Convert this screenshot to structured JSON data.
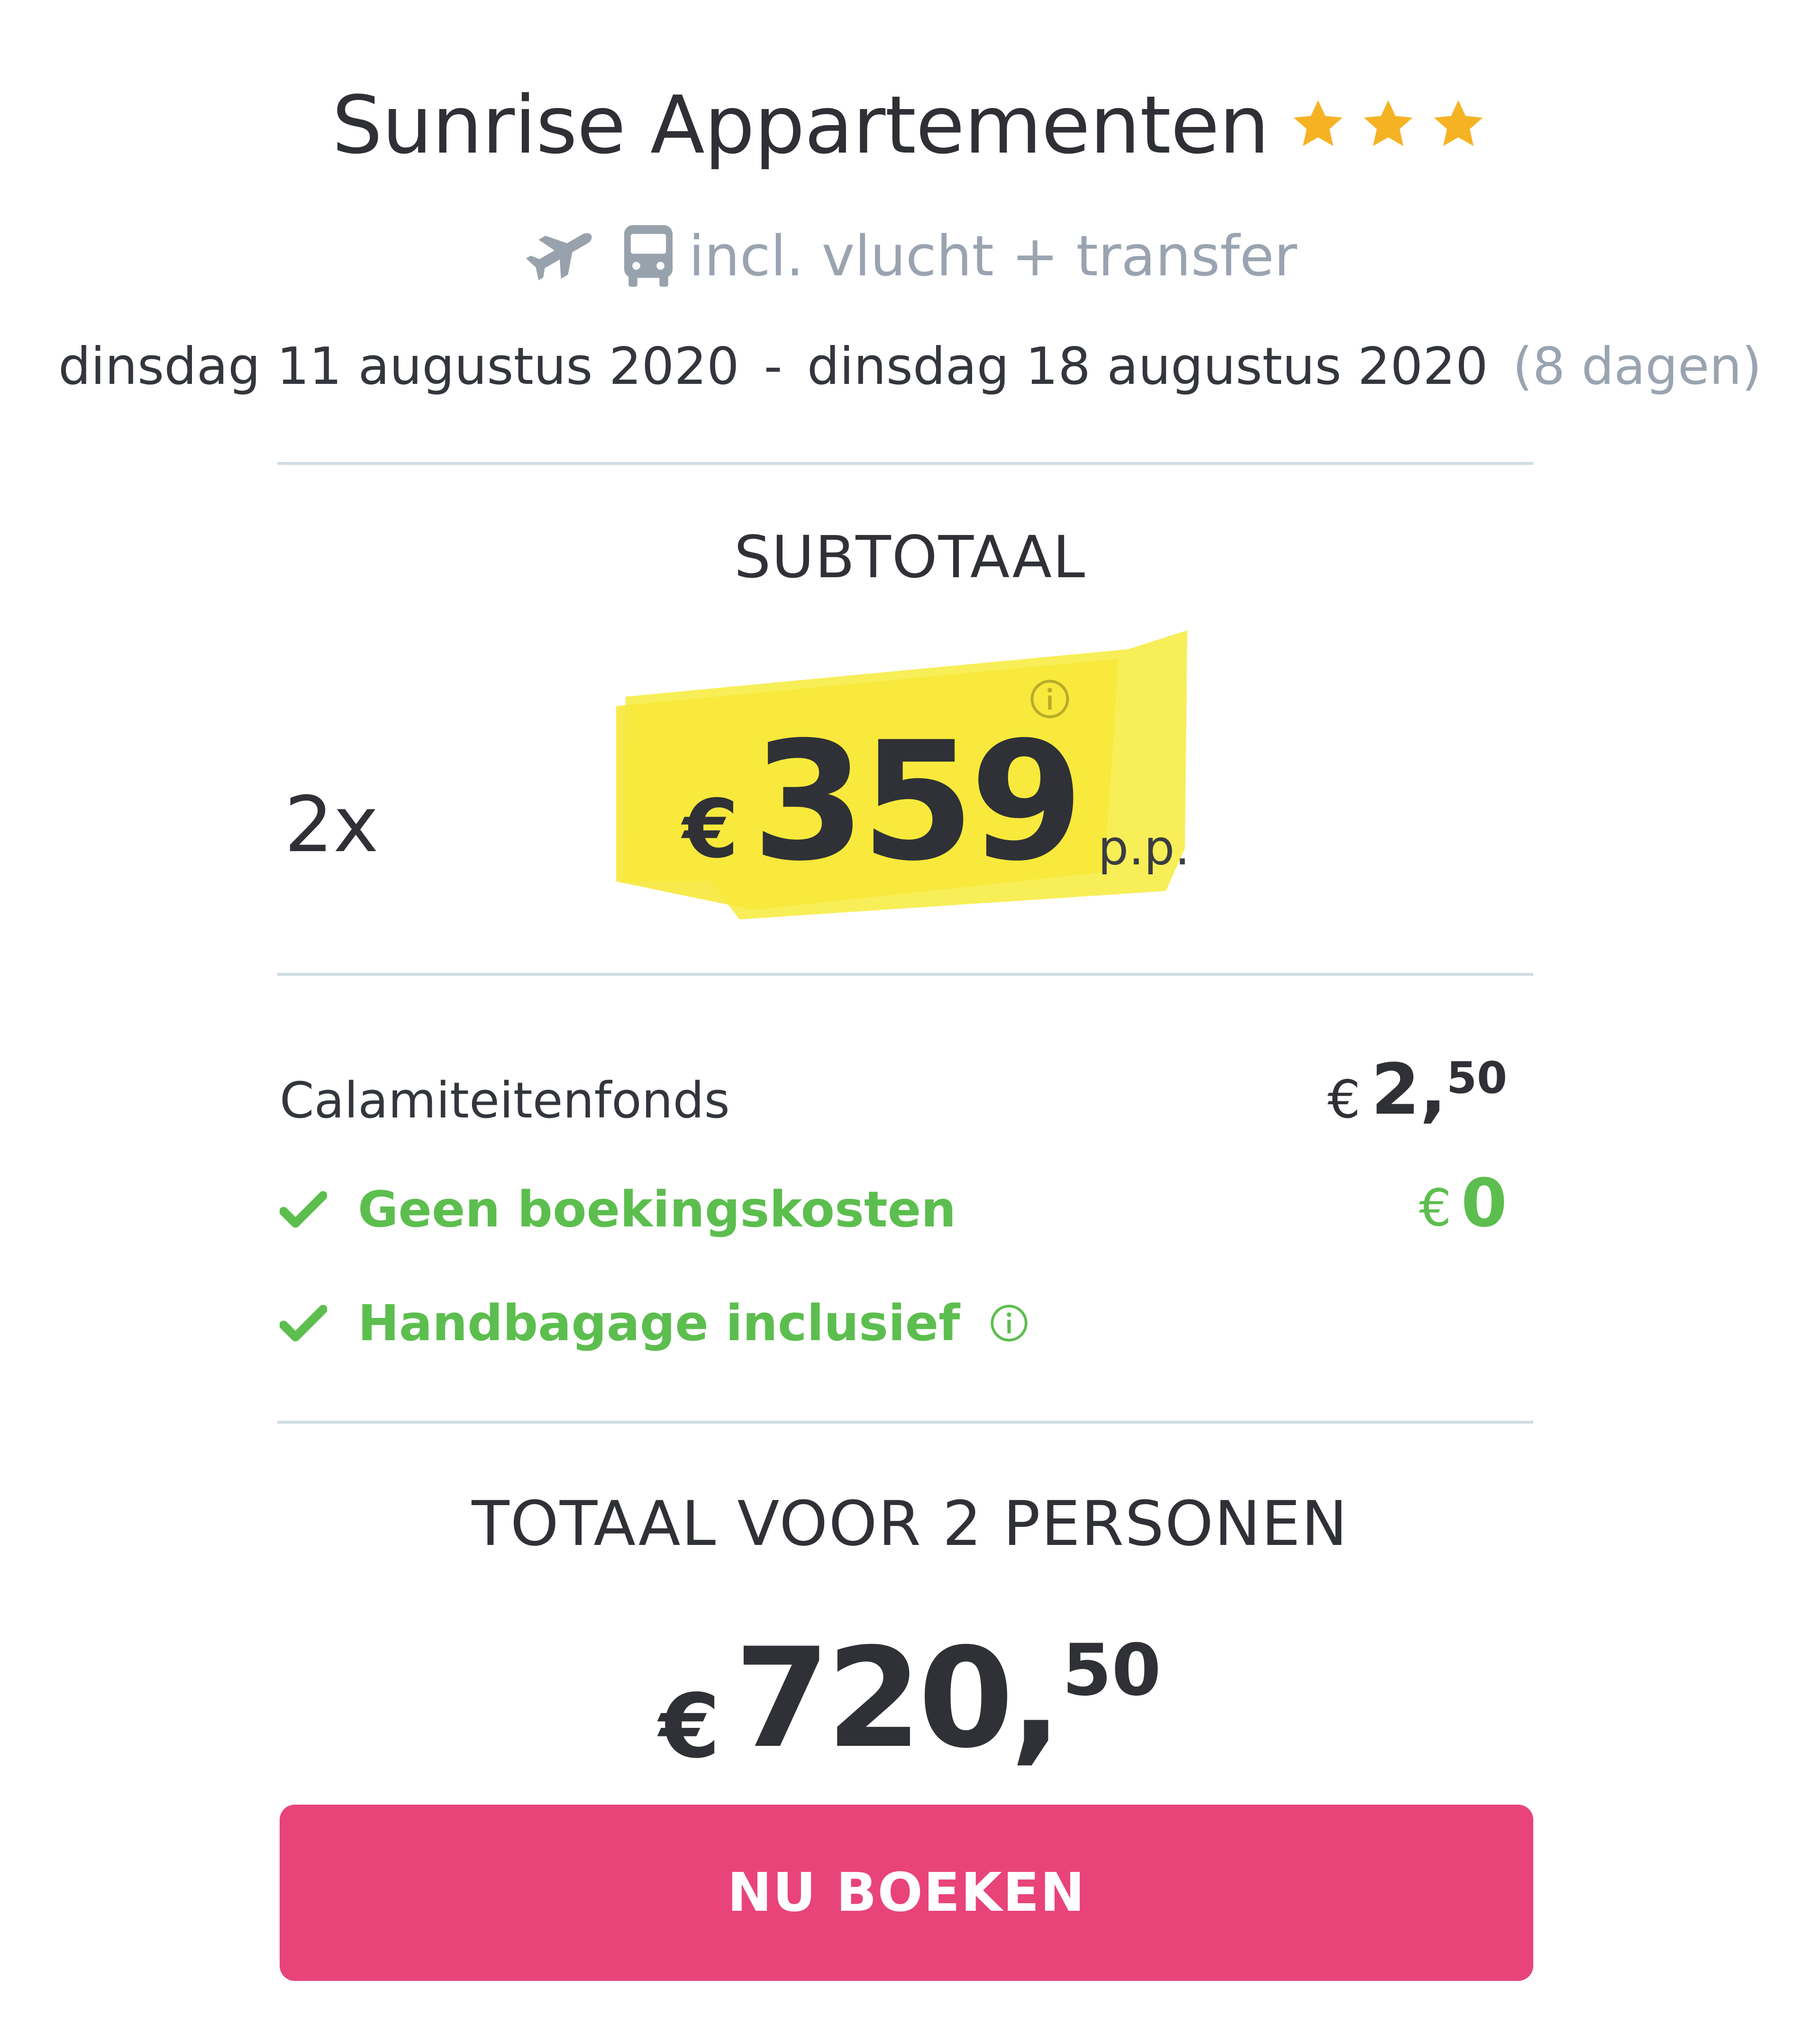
{
  "header": {
    "hotel_name": "Sunrise Appartementen",
    "stars": 3,
    "star_color": "#f5b324",
    "includes_icons": [
      "airplane-icon",
      "bus-icon"
    ],
    "includes_text": "incl. vlucht + transfer",
    "date_from": "dinsdag 11 augustus 2020",
    "date_separator": "-",
    "date_to": "dinsdag 18 augustus 2020",
    "duration": "(8 dagen)"
  },
  "subtotal": {
    "label": "SUBTOTAAL",
    "quantity": "2x",
    "currency": "€",
    "price": "359",
    "per_person": "p.p.",
    "highlight_color": "#f7eb3a"
  },
  "fees": {
    "calamity_label": "Calamiteitenfonds",
    "calamity_currency": "€",
    "calamity_whole": "2,",
    "calamity_cents": "50",
    "booking_label": "Geen boekingskosten",
    "booking_currency": "€",
    "booking_value": "0",
    "baggage_label": "Handbagage inclusief",
    "green_color": "#5cbe4e"
  },
  "total": {
    "label": "TOTAAL VOOR 2 PERSONEN",
    "currency": "€",
    "whole": "720,",
    "cents": "50"
  },
  "actions": {
    "book_label": "NU BOEKEN",
    "book_color": "#e8447a"
  }
}
